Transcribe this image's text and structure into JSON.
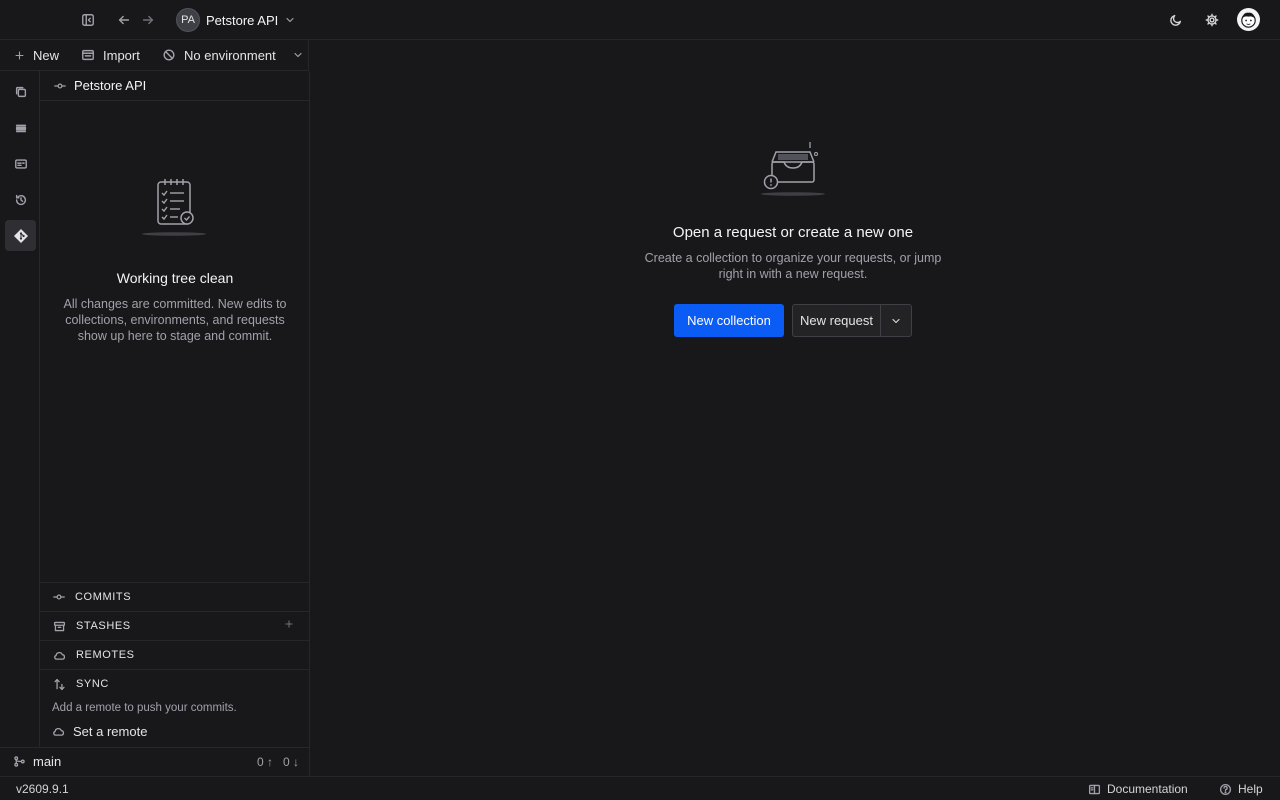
{
  "topbar": {
    "workspace_initials": "PA",
    "workspace_name": "Petstore API"
  },
  "toolbar": {
    "new_label": "New",
    "import_label": "Import",
    "environment_label": "No environment"
  },
  "sidebar": {
    "header": "Petstore API",
    "clean_title": "Working tree clean",
    "clean_desc": "All changes are committed. New edits to collections, environments, and requests show up here to stage and commit.",
    "sections": {
      "commits": "COMMITS",
      "stashes": "STASHES",
      "remotes": "REMOTES",
      "sync": "SYNC"
    },
    "sync_note": "Add a remote to push your commits.",
    "set_remote": "Set a remote"
  },
  "branch": {
    "name": "main",
    "ahead": "0 ↑",
    "behind": "0 ↓"
  },
  "main": {
    "title": "Open a request or create a new one",
    "desc": "Create a collection to organize your requests, or jump right in with a new request.",
    "primary_button": "New collection",
    "secondary_button": "New request"
  },
  "statusbar": {
    "version": "v2609.9.1",
    "documentation": "Documentation",
    "help": "Help"
  },
  "colors": {
    "background": "#18181b",
    "accent": "#0a5cf5",
    "border": "#27272a"
  }
}
